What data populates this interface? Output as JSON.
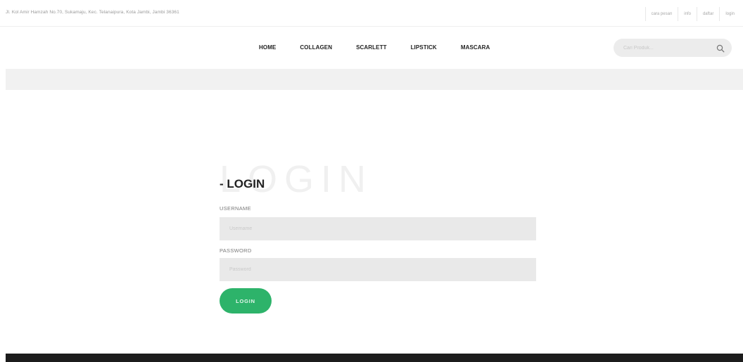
{
  "topbar": {
    "address": "Jl. Kol Amir Hamzah No.70, Sukamaju, Kec. Telanaipura, Kota Jambi, Jambi 36361",
    "links": [
      "cara pesan",
      "info",
      "daftar",
      "login"
    ]
  },
  "nav": {
    "items": [
      "HOME",
      "COLLAGEN",
      "SCARLETT",
      "LIPSTICK",
      "MASCARA"
    ],
    "search_placeholder": "Cari Produk..."
  },
  "login": {
    "background_title": "LOGIN",
    "title": "- LOGIN",
    "username_label": "USERNAME",
    "username_placeholder": "Username",
    "password_label": "PASSWORD",
    "password_placeholder": "Password",
    "button_label": "LOGIN"
  },
  "colors": {
    "accent": "#2db36a",
    "footer": "#1c1c1c",
    "field_bg": "#e9e9e9"
  }
}
